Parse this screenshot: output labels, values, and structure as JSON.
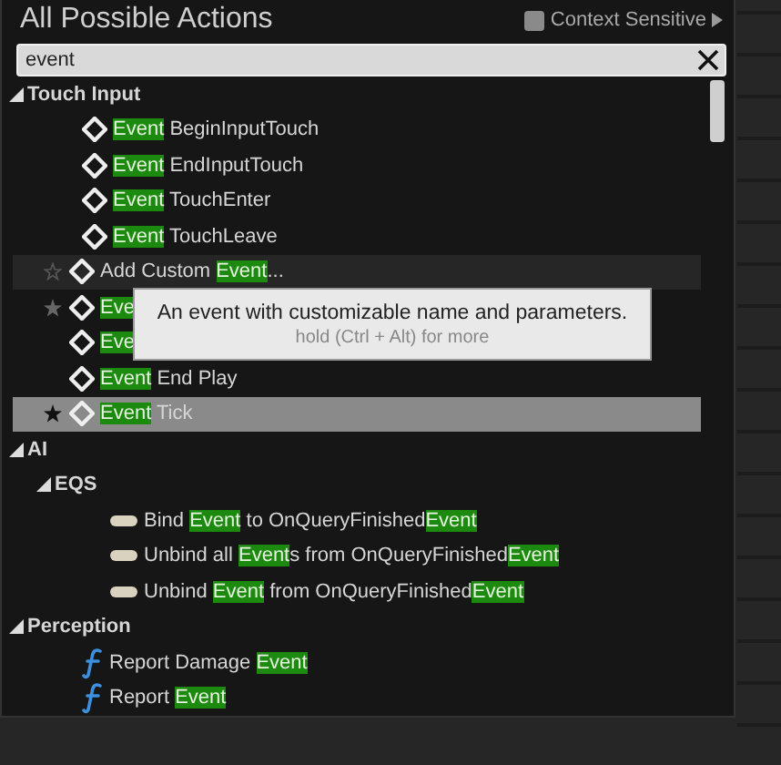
{
  "header": {
    "title": "All Possible Actions",
    "context_sensitive": {
      "label": "Context Sensitive",
      "checked": false
    }
  },
  "search": {
    "value": "event"
  },
  "tree": [
    {
      "kind": "category",
      "label": "Touch Input",
      "expanded": true,
      "children": [
        {
          "kind": "event",
          "favorite": false,
          "hovered": false,
          "selected": false,
          "label": [
            {
              "text": "Event",
              "match": true
            },
            {
              "text": " BeginInputTouch",
              "match": false
            }
          ]
        },
        {
          "kind": "event",
          "favorite": false,
          "hovered": false,
          "selected": false,
          "label": [
            {
              "text": "Event",
              "match": true
            },
            {
              "text": " EndInputTouch",
              "match": false
            }
          ]
        },
        {
          "kind": "event",
          "favorite": false,
          "hovered": false,
          "selected": false,
          "label": [
            {
              "text": "Event",
              "match": true
            },
            {
              "text": " TouchEnter",
              "match": false
            }
          ]
        },
        {
          "kind": "event",
          "favorite": false,
          "hovered": false,
          "selected": false,
          "label": [
            {
              "text": "Event",
              "match": true
            },
            {
              "text": " TouchLeave",
              "match": false
            }
          ]
        }
      ]
    },
    {
      "kind": "event",
      "favorite": false,
      "hovered": true,
      "selected": false,
      "label": [
        {
          "text": "Add Custom ",
          "match": false
        },
        {
          "text": "Event",
          "match": true
        },
        {
          "text": "...",
          "match": false
        }
      ]
    },
    {
      "kind": "event",
      "favorite": true,
      "hovered": false,
      "selected": false,
      "label": [
        {
          "text": "Eve",
          "match": true
        }
      ]
    },
    {
      "kind": "event",
      "favorite": false,
      "hovered": false,
      "selected": false,
      "label": [
        {
          "text": "Eve",
          "match": true
        }
      ]
    },
    {
      "kind": "event",
      "favorite": false,
      "hovered": false,
      "selected": false,
      "label": [
        {
          "text": "Event",
          "match": true
        },
        {
          "text": " End Play",
          "match": false
        }
      ]
    },
    {
      "kind": "event",
      "favorite": true,
      "hovered": false,
      "selected": true,
      "label": [
        {
          "text": "Event",
          "match": true
        },
        {
          "text": " Tick",
          "match": false
        }
      ]
    },
    {
      "kind": "category",
      "label": "AI",
      "expanded": true,
      "children": [
        {
          "kind": "category",
          "label": "EQS",
          "expanded": true,
          "children": [
            {
              "kind": "delegate",
              "favorite": false,
              "hovered": false,
              "selected": false,
              "label": [
                {
                  "text": "Bind ",
                  "match": false
                },
                {
                  "text": "Event",
                  "match": true
                },
                {
                  "text": " to OnQueryFinished",
                  "match": false
                },
                {
                  "text": "Event",
                  "match": true
                }
              ]
            },
            {
              "kind": "delegate",
              "favorite": false,
              "hovered": false,
              "selected": false,
              "label": [
                {
                  "text": "Unbind all ",
                  "match": false
                },
                {
                  "text": "Event",
                  "match": true
                },
                {
                  "text": "s from OnQueryFinished",
                  "match": false
                },
                {
                  "text": "Event",
                  "match": true
                }
              ]
            },
            {
              "kind": "delegate",
              "favorite": false,
              "hovered": false,
              "selected": false,
              "label": [
                {
                  "text": "Unbind ",
                  "match": false
                },
                {
                  "text": "Event",
                  "match": true
                },
                {
                  "text": " from OnQueryFinished",
                  "match": false
                },
                {
                  "text": "Event",
                  "match": true
                }
              ]
            }
          ]
        }
      ]
    },
    {
      "kind": "category",
      "label": "Perception",
      "expanded": true,
      "children": [
        {
          "kind": "function",
          "favorite": false,
          "hovered": false,
          "selected": false,
          "label": [
            {
              "text": "Report Damage ",
              "match": false
            },
            {
              "text": "Event",
              "match": true
            }
          ]
        },
        {
          "kind": "function",
          "favorite": false,
          "hovered": false,
          "selected": false,
          "label": [
            {
              "text": "Report ",
              "match": false
            },
            {
              "text": "Event",
              "match": true
            }
          ]
        }
      ]
    }
  ],
  "tooltip": {
    "text": "An event with customizable name and parameters.",
    "hint": "hold (Ctrl + Alt) for more"
  }
}
